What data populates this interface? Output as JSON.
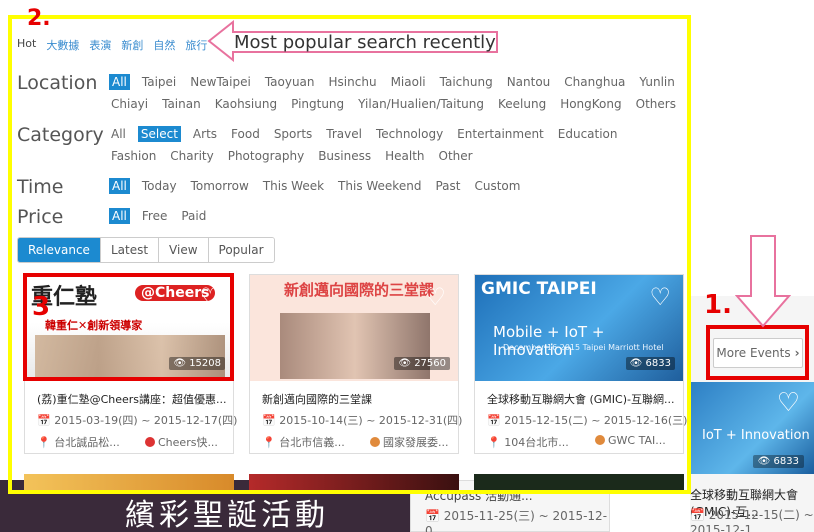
{
  "hot": {
    "label": "Hot",
    "tags": [
      "大數據",
      "表演",
      "新創",
      "自然",
      "旅行"
    ]
  },
  "annotations": {
    "callout": "Most popular search recently",
    "label1": "1.",
    "label2": "2.",
    "label3": "3",
    "frame_color": "#ffff00",
    "box_color": "#e60000"
  },
  "filters": {
    "location": {
      "label": "Location",
      "options": [
        "All",
        "Taipei",
        "NewTaipei",
        "Taoyuan",
        "Hsinchu",
        "Miaoli",
        "Taichung",
        "Nantou",
        "Changhua",
        "Yunlin",
        "Chiayi",
        "Tainan",
        "Kaohsiung",
        "Pingtung",
        "Yilan/Hualien/Taitung",
        "Keelung",
        "HongKong",
        "Others"
      ],
      "selected": "All"
    },
    "category": {
      "label": "Category",
      "options": [
        "All",
        "Select",
        "Arts",
        "Food",
        "Sports",
        "Travel",
        "Technology",
        "Entertainment",
        "Education",
        "Fashion",
        "Charity",
        "Photography",
        "Business",
        "Health",
        "Other"
      ],
      "selected": "Select"
    },
    "time": {
      "label": "Time",
      "options": [
        "All",
        "Today",
        "Tomorrow",
        "This Week",
        "This Weekend",
        "Past",
        "Custom"
      ],
      "selected": "All"
    },
    "price": {
      "label": "Price",
      "options": [
        "All",
        "Free",
        "Paid"
      ],
      "selected": "All"
    }
  },
  "sort": {
    "options": [
      "Relevance",
      "Latest",
      "View",
      "Popular"
    ],
    "selected": "Relevance"
  },
  "more_events": "More Events",
  "accent_color": "#1c8ad0",
  "cards": [
    {
      "image_text": [
        "重仁塾",
        "@Cheers",
        "韓重仁✕創新領導家"
      ],
      "views": "15208",
      "title": "(荔)重仁塾@Cheers講座：超值優惠...",
      "date": "2015-03-19(四) ~ 2015-12-17(四)",
      "location": "台北誠品松...",
      "organizer": "Cheers快..."
    },
    {
      "image_text": [
        "新創邁向國際的三堂課"
      ],
      "views": "27560",
      "title": "新創邁向國際的三堂課",
      "date": "2015-10-14(三) ~ 2015-12-31(四)",
      "location": "台北市信義...",
      "organizer": "國家發展委..."
    },
    {
      "image_text": [
        "GMIC TAIPEI",
        "Mobile + IoT + Innovation",
        "December 16 2015 Taipei Marriott Hotel"
      ],
      "views": "6833",
      "title": "全球移動互聯網大會 (GMIC)-互聯網...",
      "date": "2015-12-15(二) ~ 2015-12-16(三)",
      "location": "104台北市...",
      "organizer": "GWC TAI..."
    }
  ],
  "background": {
    "right_card": {
      "image_text": "IoT + Innovation",
      "views": "6833",
      "title": "全球移動互聯網大會 (GMIC)-互...",
      "date": "2015-12-15(二) ~ 2015-12-1..."
    },
    "mid_card": {
      "title": "Accupass 活動通...",
      "date": "2015-11-25(三) ~ 2015-12-0..."
    },
    "left_banner": "繽彩聖誕活動"
  }
}
